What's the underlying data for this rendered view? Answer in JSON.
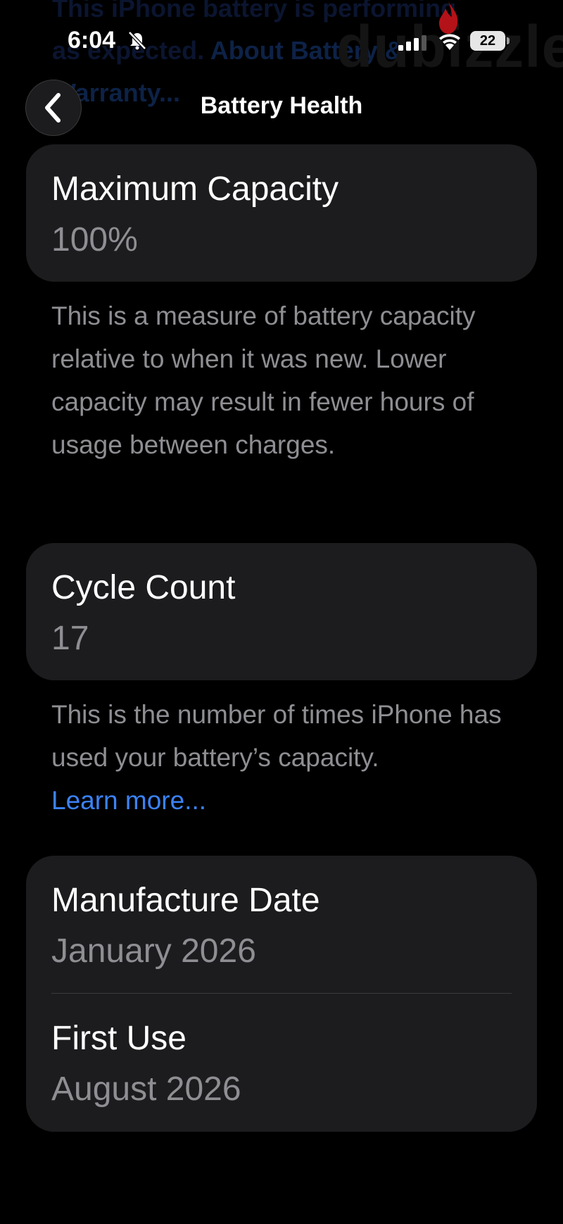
{
  "background_text": {
    "line1": "This iPhone battery is performing",
    "line2_prefix": "as expected.",
    "line2_link": "About Battery &",
    "line3": "Warranty...",
    "watermark": "dubizzle"
  },
  "status_bar": {
    "time": "6:04",
    "battery_level": "22"
  },
  "nav": {
    "back_icon": "chevron-left-icon",
    "title": "Battery Health"
  },
  "maximum_capacity": {
    "title": "Maximum Capacity",
    "value": "100%",
    "description": "This is a measure of battery capacity relative to when it was new. Lower capacity may result in fewer hours of usage between charges."
  },
  "cycle_count": {
    "title": "Cycle Count",
    "value": "17",
    "description": "This is the number of times iPhone has used your battery’s capacity.",
    "learn_more": "Learn more..."
  },
  "dates": {
    "manufacture_title": "Manufacture Date",
    "manufacture_value": "January 2026",
    "first_use_title": "First Use",
    "first_use_value": "August 2026"
  },
  "colors": {
    "background": "#000000",
    "card": "#1c1c1e",
    "secondary_text": "#8e8e93",
    "link": "#3b82f6"
  }
}
